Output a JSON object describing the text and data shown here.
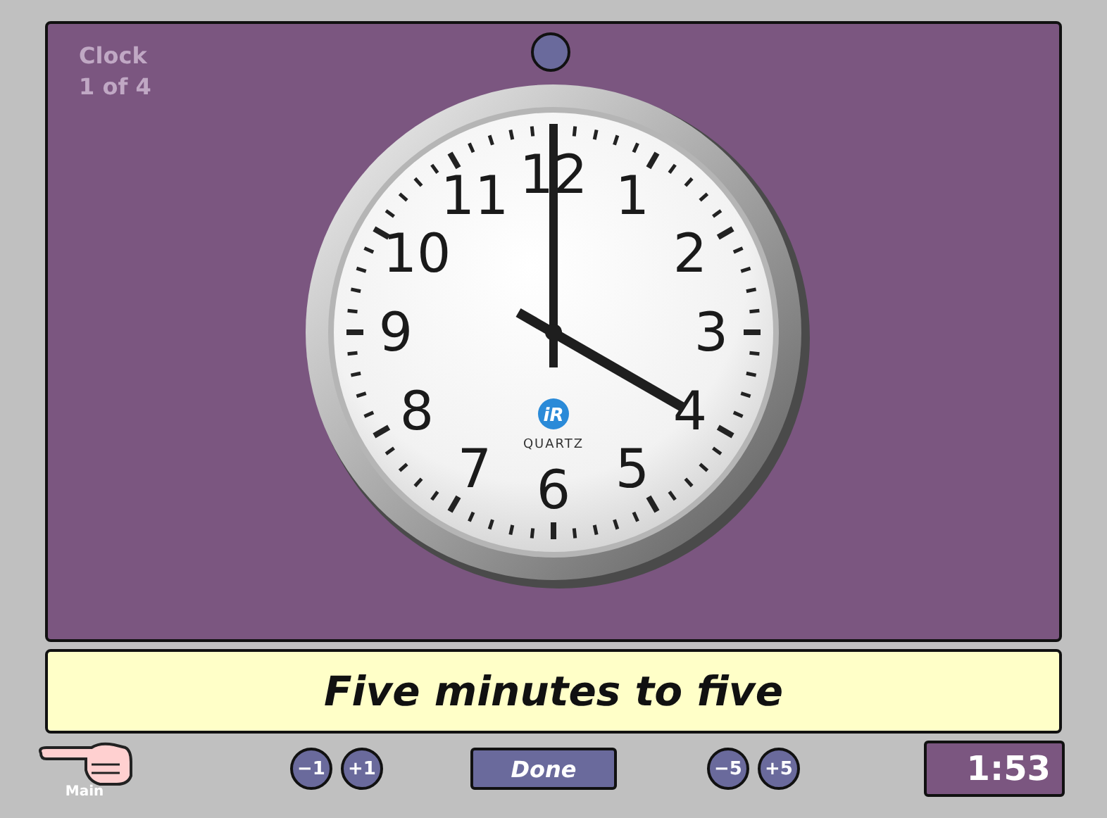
{
  "header": {
    "title": "Clock",
    "counter": "1 of 4"
  },
  "clock": {
    "numerals": [
      "12",
      "11",
      "1",
      "10",
      "2",
      "9",
      "3",
      "8",
      "4",
      "7",
      "5",
      "6"
    ],
    "logo_mark": "iR",
    "brand": "QUARTZ"
  },
  "caption": "Five minutes to five",
  "footer": {
    "main_label": "Main",
    "buttons_left": [
      "−1",
      "+1"
    ],
    "done": "Done",
    "buttons_right": [
      "−5",
      "+5"
    ],
    "timer": "1:53"
  }
}
